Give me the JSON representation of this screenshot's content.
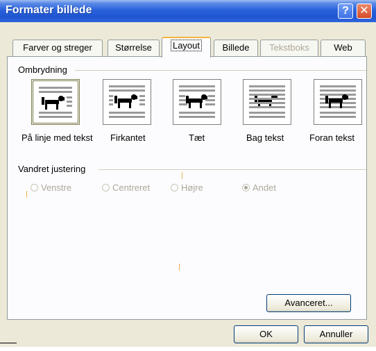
{
  "window": {
    "title": "Formater billede",
    "help_glyph": "?",
    "close_glyph": "✕"
  },
  "tabs": [
    {
      "label": "Farver og streger",
      "state": "normal"
    },
    {
      "label": "Størrelse",
      "state": "normal"
    },
    {
      "label": "Layout",
      "state": "active"
    },
    {
      "label": "Billede",
      "state": "normal"
    },
    {
      "label": "Tekstboks",
      "state": "disabled"
    },
    {
      "label": "Web",
      "state": "normal"
    }
  ],
  "wrapping": {
    "group_label": "Ombrydning",
    "options": [
      {
        "label": "På linje med tekst",
        "selected": true
      },
      {
        "label": "Firkantet",
        "selected": false
      },
      {
        "label": "Tæt",
        "selected": false
      },
      {
        "label": "Bag tekst",
        "selected": false
      },
      {
        "label": "Foran tekst",
        "selected": false
      }
    ]
  },
  "alignment": {
    "group_label": "Vandret justering",
    "options": [
      {
        "label": "Venstre",
        "checked": false
      },
      {
        "label": "Centreret",
        "checked": false
      },
      {
        "label": "Højre",
        "checked": false
      },
      {
        "label": "Andet",
        "checked": true
      }
    ]
  },
  "buttons": {
    "advanced": "Avanceret...",
    "ok": "OK",
    "cancel": "Annuller"
  },
  "colors": {
    "title_bar": "#2a62dc",
    "dialog_bg": "#ece9d8",
    "panel_bg": "#fcfcfe",
    "active_tab_accent": "#f7b33d",
    "disabled_text": "#aca899"
  }
}
